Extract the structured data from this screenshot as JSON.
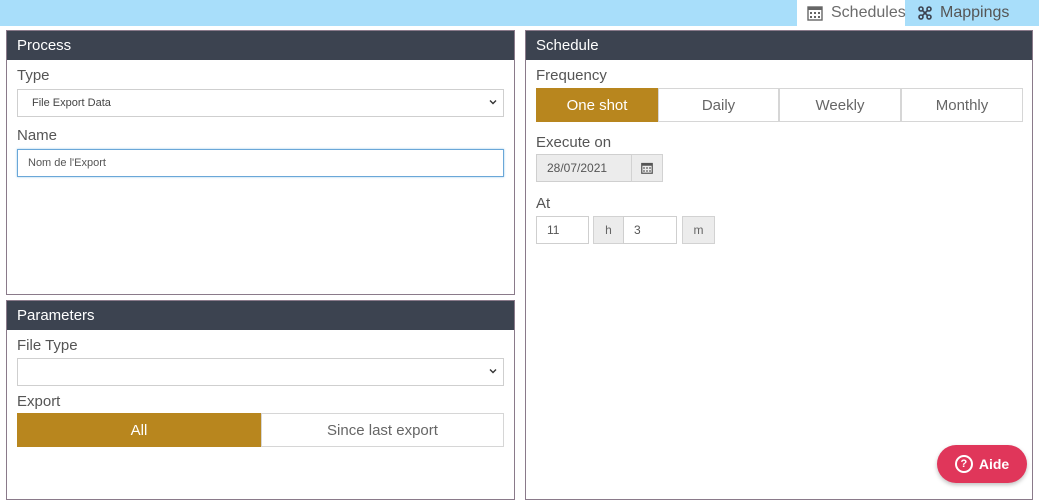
{
  "tabs": {
    "schedules": {
      "label": "Schedules",
      "icon": "calendar-icon"
    },
    "mappings": {
      "label": "Mappings",
      "icon": "mapping-icon"
    }
  },
  "process": {
    "title": "Process",
    "type_label": "Type",
    "type_value": "File Export Data",
    "name_label": "Name",
    "name_value": "Nom de l'Export"
  },
  "parameters": {
    "title": "Parameters",
    "file_type_label": "File Type",
    "file_type_value": "",
    "export_label": "Export",
    "export_options": [
      "All",
      "Since last export"
    ],
    "export_selected": "All"
  },
  "schedule": {
    "title": "Schedule",
    "frequency_label": "Frequency",
    "frequency_options": [
      "One shot",
      "Daily",
      "Weekly",
      "Monthly"
    ],
    "frequency_selected": "One shot",
    "execute_on_label": "Execute on",
    "execute_on_value": "28/07/2021",
    "at_label": "At",
    "hour_value": "11",
    "hour_unit": "h",
    "minute_value": "3",
    "minute_unit": "m"
  },
  "help_button": {
    "label": "Aide",
    "icon": "question-circle-icon"
  },
  "colors": {
    "accent": "#b8861e",
    "header": "#3c4350",
    "topbar": "#a8defa",
    "help": "#e0365a"
  }
}
